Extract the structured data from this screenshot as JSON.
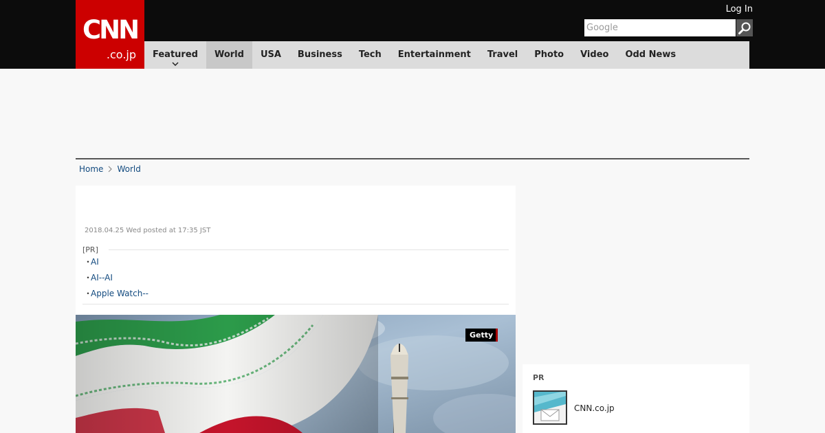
{
  "header": {
    "logo_mark": "CNN",
    "logo_sub": ".co.jp",
    "login_label": "Log In",
    "search_placeholder": "Google"
  },
  "nav": {
    "items": [
      {
        "label": "Featured",
        "has_dropdown": true
      },
      {
        "label": "World",
        "active": true
      },
      {
        "label": "USA"
      },
      {
        "label": "Business"
      },
      {
        "label": "Tech"
      },
      {
        "label": "Entertainment"
      },
      {
        "label": "Travel"
      },
      {
        "label": "Photo"
      },
      {
        "label": "Video"
      },
      {
        "label": "Odd News"
      }
    ]
  },
  "breadcrumb": {
    "home": "Home",
    "section": "World"
  },
  "article": {
    "posted": "2018.04.25 Wed posted at 17:35 JST",
    "pr_label": "[PR]",
    "pr_links": [
      {
        "bullet": "・",
        "text": "AI"
      },
      {
        "bullet": "・",
        "text": "AI--AI"
      },
      {
        "bullet": "・",
        "text": "Apple Watch--"
      }
    ],
    "image_credit": "Getty"
  },
  "sidebar": {
    "pr_title": "PR",
    "pr_item_name": "CNN.co.jp"
  },
  "colors": {
    "brand_red": "#cc0000",
    "topbar": "#0c0c0c",
    "nav_bg": "#dcdcdc",
    "link": "#124a7f"
  }
}
